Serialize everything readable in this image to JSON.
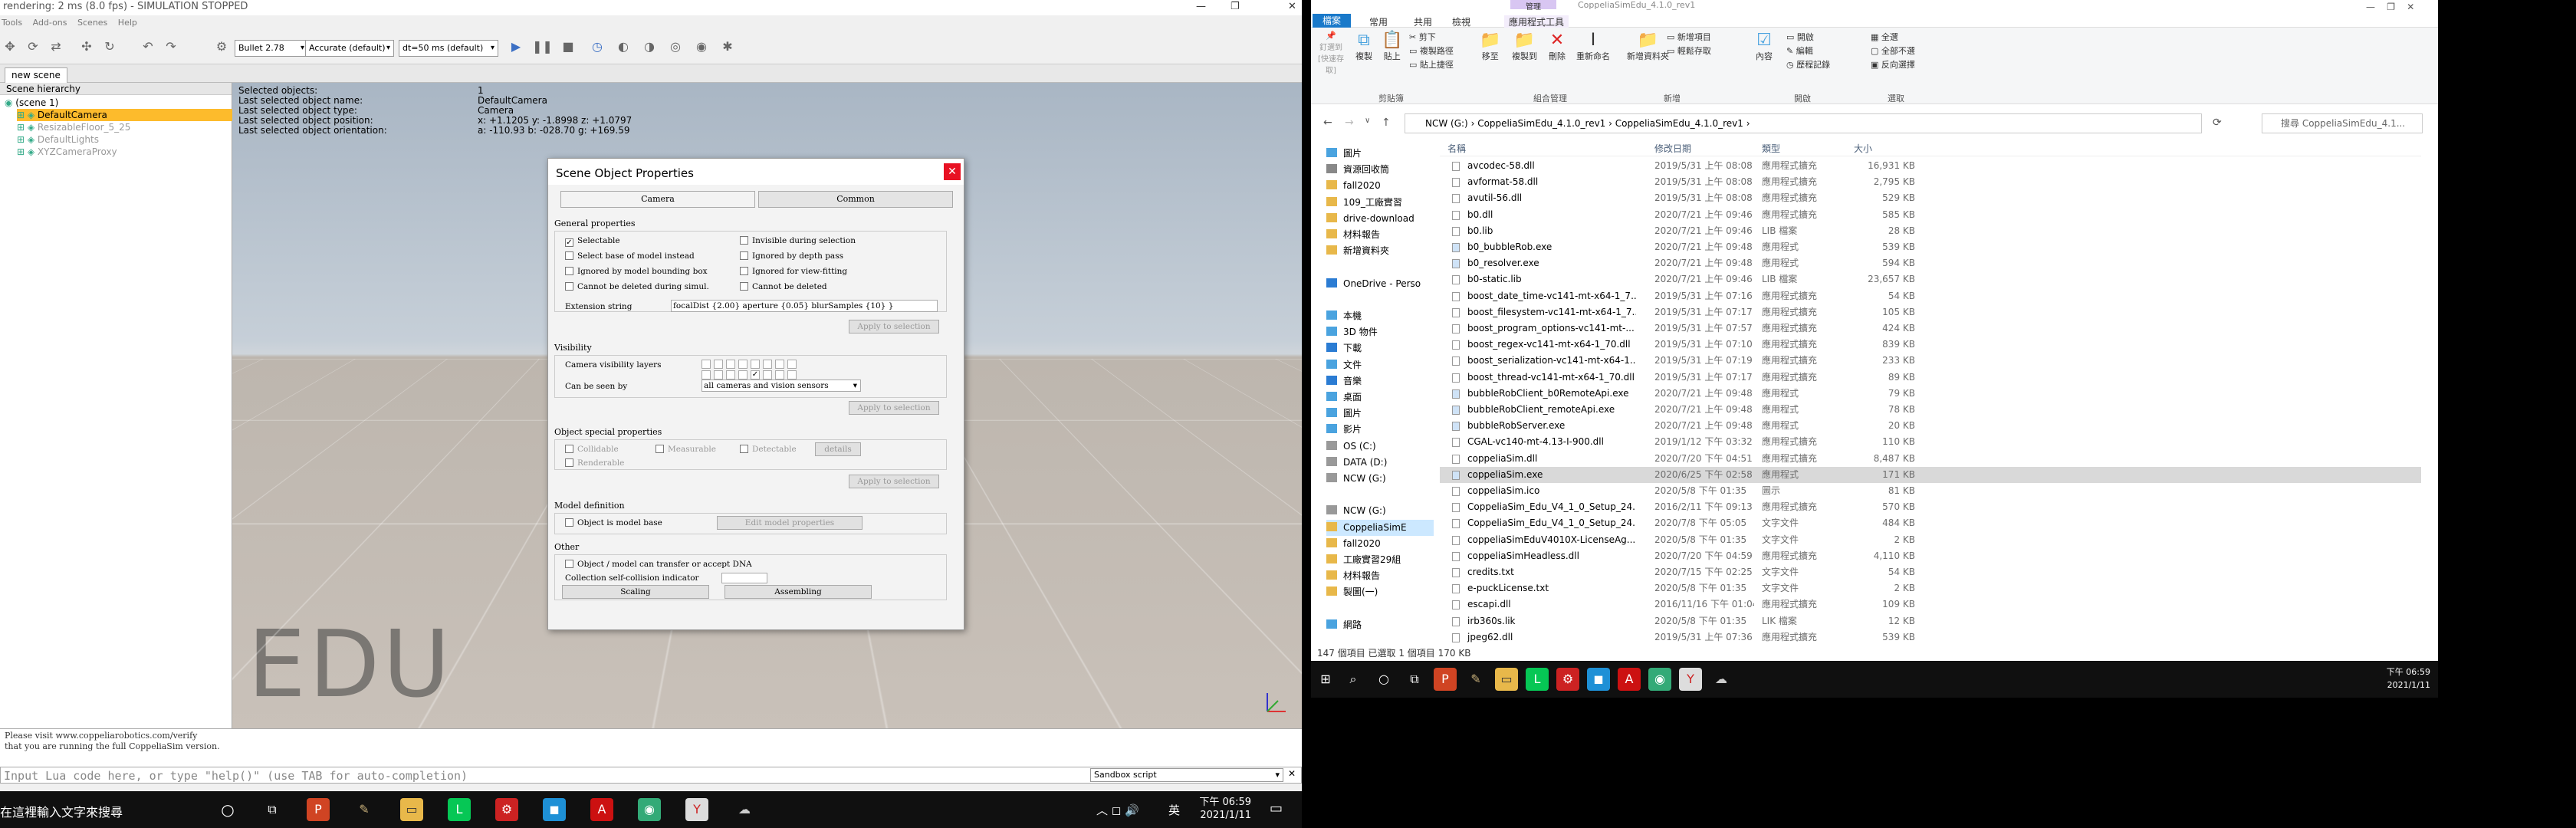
{
  "coppelia": {
    "title": "rendering: 2 ms (8.0 fps) - SIMULATION STOPPED",
    "menu": [
      "Tools",
      "Add-ons",
      "Scenes",
      "Help"
    ],
    "toolbar": {
      "engine": "Bullet 2.78",
      "accuracy": "Accurate (default)",
      "dt": "dt=50 ms (default)"
    },
    "scene_tab": "new scene",
    "hierarchy": {
      "header": "Scene hierarchy",
      "items": [
        {
          "label": "(scene 1)",
          "indent": 0,
          "selected": false,
          "dim": false
        },
        {
          "label": "DefaultCamera",
          "indent": 1,
          "selected": true,
          "dim": false
        },
        {
          "label": "ResizableFloor_5_25",
          "indent": 1,
          "selected": false,
          "dim": true
        },
        {
          "label": "DefaultLights",
          "indent": 1,
          "selected": false,
          "dim": true
        },
        {
          "label": "XYZCameraProxy",
          "indent": 1,
          "selected": false,
          "dim": true
        }
      ]
    },
    "info": [
      {
        "k": "Selected objects:",
        "v": "1"
      },
      {
        "k": "Last selected object name:",
        "v": "DefaultCamera"
      },
      {
        "k": "Last selected object type:",
        "v": "Camera"
      },
      {
        "k": "Last selected object position:",
        "v": "x: +1.1205    y: -1.8998    z: +1.0797"
      },
      {
        "k": "Last selected object orientation:",
        "v": "a: -110.93    b: -028.70    g: +169.59"
      }
    ],
    "watermark": "EDU",
    "dialog": {
      "title": "Scene Object Properties",
      "tabs": [
        "Camera",
        "Common"
      ],
      "general": "General properties",
      "left_checks": [
        {
          "label": "Selectable",
          "checked": true
        },
        {
          "label": "Select base of model instead",
          "checked": false
        },
        {
          "label": "Ignored by model bounding box",
          "checked": false
        },
        {
          "label": "Cannot be deleted during simul.",
          "checked": false
        }
      ],
      "right_checks": [
        {
          "label": "Invisible during selection",
          "checked": false
        },
        {
          "label": "Ignored by depth pass",
          "checked": false
        },
        {
          "label": "Ignored for view-fitting",
          "checked": false
        },
        {
          "label": "Cannot be deleted",
          "checked": false
        }
      ],
      "ext_label": "Extension string",
      "ext_value": "focalDist {2.00} aperture {0.05} blurSamples {10} }",
      "apply": "Apply to selection",
      "visibility": "Visibility",
      "cam_layers": "Camera visibility layers",
      "can_be_seen": "Can be seen by",
      "seen_value": "all cameras and vision sensors",
      "special": "Object special properties",
      "special_checks": [
        "Collidable",
        "Measurable",
        "Detectable",
        "Renderable"
      ],
      "details": "details",
      "model_def": "Model definition",
      "model_base": "Object is model base",
      "edit_model": "Edit model properties",
      "other": "Other",
      "dna": "Object / model can transfer or accept DNA",
      "self_coll": "Collection self-collision indicator",
      "scaling": "Scaling",
      "assembling": "Assembling"
    },
    "bottom_text": [
      "Please visit www.coppeliarobotics.com/verify",
      "that you are running the full CoppeliaSim version."
    ],
    "lua_placeholder": "Input Lua code here, or type \"help()\" (use TAB for auto-completion)",
    "sandbox": "Sandbox script",
    "taskbar": {
      "search": "在這裡輸入文字來搜尋",
      "time": "下午 06:59",
      "date": "2021/1/11",
      "lang": "英"
    }
  },
  "explorer": {
    "title": "CoppeliaSimEdu_4.1.0_rev1",
    "context": "管理",
    "ribbon_tabs": [
      "檔案",
      "常用",
      "共用",
      "檢視",
      "應用程式工具"
    ],
    "ribbon_groups": [
      {
        "label": "剪貼簿",
        "items": [
          "釘選到[快速存取]",
          "複製",
          "貼上",
          "剪下",
          "複製路徑",
          "貼上捷徑"
        ]
      },
      {
        "label": "組合管理",
        "items": [
          "移至",
          "複製到",
          "刪除",
          "重新命名"
        ]
      },
      {
        "label": "新增",
        "items": [
          "新增資料夾",
          "新增項目",
          "輕鬆存取"
        ]
      },
      {
        "label": "開啟",
        "items": [
          "內容",
          "開啟",
          "編輯",
          "歷程記錄"
        ]
      },
      {
        "label": "選取",
        "items": [
          "全選",
          "全部不選",
          "反向選擇"
        ]
      }
    ],
    "path": [
      "NCW (G:)",
      "CoppeliaSimEdu_4.1.0_rev1",
      "CoppeliaSimEdu_4.1.0_rev1"
    ],
    "search_placeholder": "搜尋 CoppeliaSimEdu_4.1...",
    "nav": [
      {
        "label": "圖片",
        "color": "#4aa3df"
      },
      {
        "label": "資源回收筒",
        "color": "#888"
      },
      {
        "label": "fall2020",
        "color": "#e8b84a"
      },
      {
        "label": "109_工廠實習",
        "color": "#e8b84a"
      },
      {
        "label": "drive-download",
        "color": "#e8b84a"
      },
      {
        "label": "材料報告",
        "color": "#e8b84a"
      },
      {
        "label": "新增資料夾",
        "color": "#e8b84a"
      },
      {
        "label": "",
        "color": "#fff"
      },
      {
        "label": "OneDrive - Perso",
        "color": "#2b7cd3"
      },
      {
        "label": "",
        "color": "#fff"
      },
      {
        "label": "本機",
        "color": "#4aa3df"
      },
      {
        "label": "3D 物件",
        "color": "#4aa3df"
      },
      {
        "label": "下載",
        "color": "#2b7cd3"
      },
      {
        "label": "文件",
        "color": "#4aa3df"
      },
      {
        "label": "音樂",
        "color": "#2b7cd3"
      },
      {
        "label": "桌面",
        "color": "#4aa3df"
      },
      {
        "label": "圖片",
        "color": "#4aa3df"
      },
      {
        "label": "影片",
        "color": "#4aa3df"
      },
      {
        "label": "OS (C:)",
        "color": "#999"
      },
      {
        "label": "DATA (D:)",
        "color": "#999"
      },
      {
        "label": "NCW (G:)",
        "color": "#999"
      },
      {
        "label": "",
        "color": "#fff"
      },
      {
        "label": "NCW (G:)",
        "color": "#999"
      },
      {
        "label": "CoppeliaSimE",
        "color": "#e8b84a"
      },
      {
        "label": "fall2020",
        "color": "#e8b84a"
      },
      {
        "label": "工廠實習29組",
        "color": "#e8b84a"
      },
      {
        "label": "材料報告",
        "color": "#e8b84a"
      },
      {
        "label": "製圖(一)",
        "color": "#e8b84a"
      },
      {
        "label": "",
        "color": "#fff"
      },
      {
        "label": "網路",
        "color": "#4aa3df"
      }
    ],
    "columns": [
      "名稱",
      "修改日期",
      "類型",
      "大小"
    ],
    "files": [
      {
        "name": "avcodec-58.dll",
        "date": "2019/5/31 上午 08:08",
        "type": "應用程式擴充",
        "size": "16,931 KB"
      },
      {
        "name": "avformat-58.dll",
        "date": "2019/5/31 上午 08:08",
        "type": "應用程式擴充",
        "size": "2,795 KB"
      },
      {
        "name": "avutil-56.dll",
        "date": "2019/5/31 上午 08:08",
        "type": "應用程式擴充",
        "size": "529 KB"
      },
      {
        "name": "b0.dll",
        "date": "2020/7/21 上午 09:46",
        "type": "應用程式擴充",
        "size": "585 KB"
      },
      {
        "name": "b0.lib",
        "date": "2020/7/21 上午 09:46",
        "type": "LIB 檔案",
        "size": "28 KB"
      },
      {
        "name": "b0_bubbleRob.exe",
        "date": "2020/7/21 上午 09:48",
        "type": "應用程式",
        "size": "539 KB"
      },
      {
        "name": "b0_resolver.exe",
        "date": "2020/7/21 上午 09:48",
        "type": "應用程式",
        "size": "594 KB"
      },
      {
        "name": "b0-static.lib",
        "date": "2020/7/21 上午 09:46",
        "type": "LIB 檔案",
        "size": "23,657 KB"
      },
      {
        "name": "boost_date_time-vc141-mt-x64-1_7...",
        "date": "2019/5/31 上午 07:16",
        "type": "應用程式擴充",
        "size": "54 KB"
      },
      {
        "name": "boost_filesystem-vc141-mt-x64-1_7...",
        "date": "2019/5/31 上午 07:17",
        "type": "應用程式擴充",
        "size": "105 KB"
      },
      {
        "name": "boost_program_options-vc141-mt-...",
        "date": "2019/5/31 上午 07:57",
        "type": "應用程式擴充",
        "size": "424 KB"
      },
      {
        "name": "boost_regex-vc141-mt-x64-1_70.dll",
        "date": "2019/5/31 上午 07:10",
        "type": "應用程式擴充",
        "size": "839 KB"
      },
      {
        "name": "boost_serialization-vc141-mt-x64-1...",
        "date": "2019/5/31 上午 07:19",
        "type": "應用程式擴充",
        "size": "233 KB"
      },
      {
        "name": "boost_thread-vc141-mt-x64-1_70.dll",
        "date": "2019/5/31 上午 07:17",
        "type": "應用程式擴充",
        "size": "89 KB"
      },
      {
        "name": "bubbleRobClient_b0RemoteApi.exe",
        "date": "2020/7/21 上午 09:48",
        "type": "應用程式",
        "size": "79 KB"
      },
      {
        "name": "bubbleRobClient_remoteApi.exe",
        "date": "2020/7/21 上午 09:48",
        "type": "應用程式",
        "size": "78 KB"
      },
      {
        "name": "bubbleRobServer.exe",
        "date": "2020/7/21 上午 09:48",
        "type": "應用程式",
        "size": "20 KB"
      },
      {
        "name": "CGAL-vc140-mt-4.13-I-900.dll",
        "date": "2019/1/12 下午 03:32",
        "type": "應用程式擴充",
        "size": "110 KB"
      },
      {
        "name": "coppeliaSim.dll",
        "date": "2020/7/20 下午 04:51",
        "type": "應用程式擴充",
        "size": "8,487 KB"
      },
      {
        "name": "coppeliaSim.exe",
        "date": "2020/6/25 下午 02:58",
        "type": "應用程式",
        "size": "171 KB"
      },
      {
        "name": "coppeliaSim.ico",
        "date": "2020/5/8 下午 01:35",
        "type": "圖示",
        "size": "81 KB"
      },
      {
        "name": "CoppeliaSim_Edu_V4_1_0_Setup_24...",
        "date": "2016/2/11 下午 09:13",
        "type": "應用程式擴充",
        "size": "570 KB"
      },
      {
        "name": "CoppeliaSim_Edu_V4_1_0_Setup_24...",
        "date": "2020/7/8 下午 05:05",
        "type": "文字文件",
        "size": "484 KB"
      },
      {
        "name": "coppeliaSimEduV4010X-LicenseAg...",
        "date": "2020/5/8 下午 01:35",
        "type": "文字文件",
        "size": "2 KB"
      },
      {
        "name": "coppeliaSimHeadless.dll",
        "date": "2020/7/20 下午 04:59",
        "type": "應用程式擴充",
        "size": "4,110 KB"
      },
      {
        "name": "credits.txt",
        "date": "2020/7/15 下午 02:25",
        "type": "文字文件",
        "size": "54 KB"
      },
      {
        "name": "e-puckLicense.txt",
        "date": "2020/5/8 下午 01:35",
        "type": "文字文件",
        "size": "2 KB"
      },
      {
        "name": "escapi.dll",
        "date": "2016/11/16 下午 01:04",
        "type": "應用程式擴充",
        "size": "109 KB"
      },
      {
        "name": "irb360s.lik",
        "date": "2020/5/8 下午 01:35",
        "type": "LIK 檔案",
        "size": "12 KB"
      },
      {
        "name": "jpeg62.dll",
        "date": "2019/5/31 上午 07:36",
        "type": "應用程式擴充",
        "size": "539 KB"
      }
    ],
    "status": "147 個項目    已選取 1 個項目 170 KB",
    "taskbar": {
      "time": "下午 06:59",
      "date": "2021/1/11"
    }
  }
}
